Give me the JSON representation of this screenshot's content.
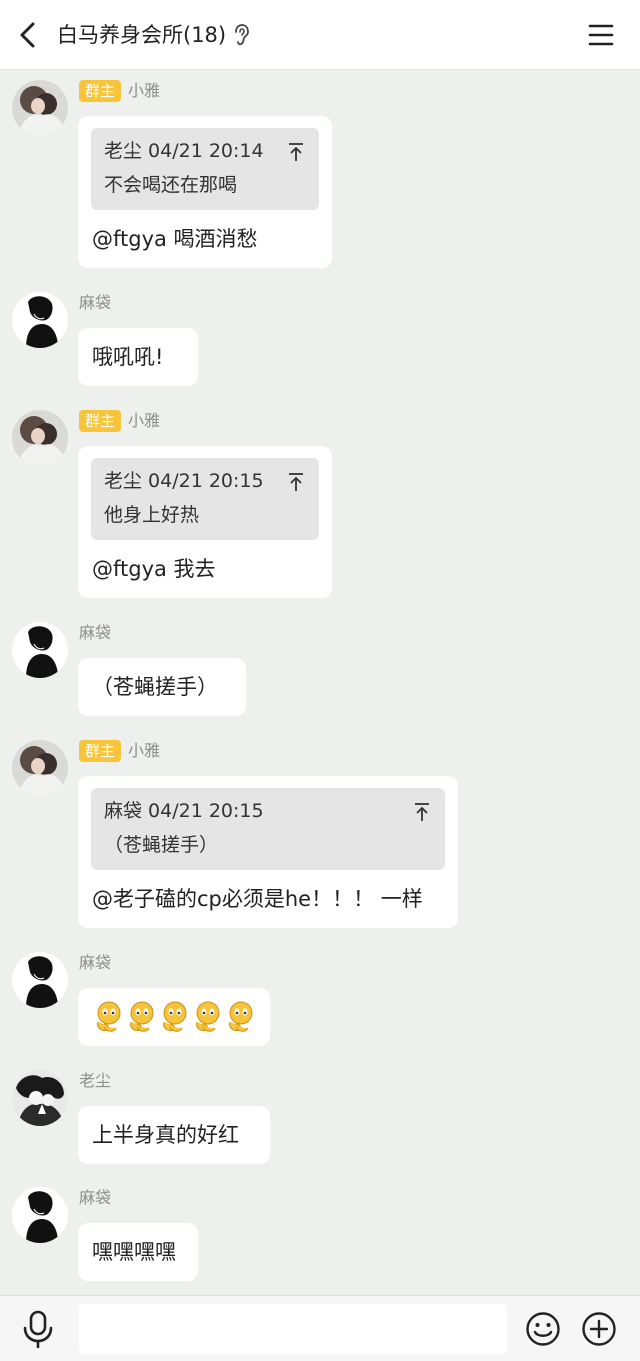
{
  "header": {
    "title": "白马养身会所(18)",
    "icons": [
      "back-arrow-icon",
      "ear-icon",
      "menu-icon"
    ]
  },
  "colors": {
    "page_bg": "#edf0ec",
    "bubble_bg": "#ffffff",
    "owner_badge": "#f7c43a",
    "quote_bg": "#e5e5e5",
    "sender_text": "#8e8e8e"
  },
  "messages": [
    {
      "sender": "小雅",
      "badge": "群主",
      "quote": {
        "meta": "老尘 04/21 20:14",
        "text": "不会喝还在那喝"
      },
      "text": "@ftgya 喝酒消愁"
    },
    {
      "sender": "麻袋",
      "text": "哦吼吼!"
    },
    {
      "sender": "小雅",
      "badge": "群主",
      "quote": {
        "meta": "老尘 04/21 20:15",
        "text": "他身上好热"
      },
      "text": "@ftgya 我去"
    },
    {
      "sender": "麻袋",
      "text": "（苍蝇搓手）"
    },
    {
      "sender": "小雅",
      "badge": "群主",
      "quote": {
        "meta": "麻袋 04/21 20:15",
        "text": "（苍蝇搓手）"
      },
      "text": "@老子磕的cp必须是he！！！ 一样"
    },
    {
      "sender": "麻袋",
      "emoji": "fly-rubbing-hands-emoji",
      "emoji_count": 5
    },
    {
      "sender": "老尘",
      "text": "上半身真的好红"
    },
    {
      "sender": "麻袋",
      "text": "嘿嘿嘿嘿"
    }
  ],
  "input_bar": {
    "placeholder": "",
    "icons": [
      "microphone-icon",
      "smiley-icon",
      "plus-icon"
    ]
  }
}
